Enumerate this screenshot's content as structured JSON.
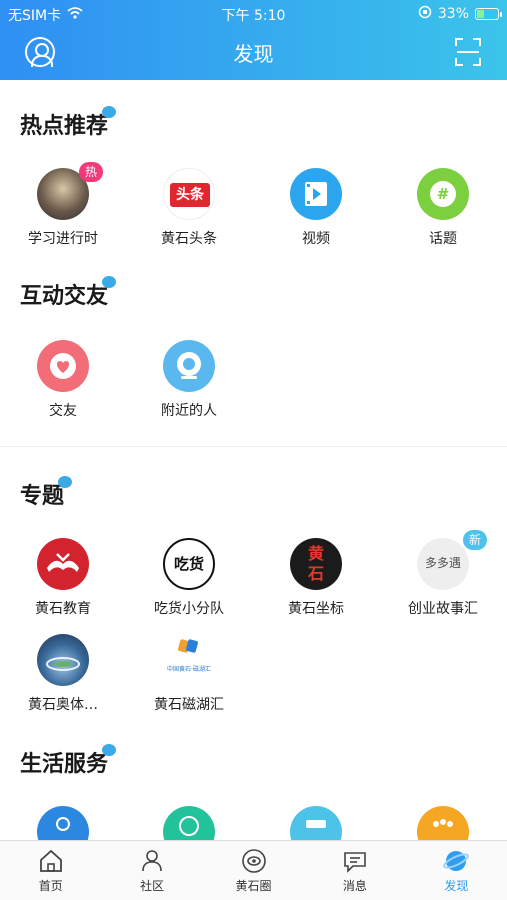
{
  "status": {
    "carrier": "无SIM卡",
    "time": "下午 5:10",
    "battery": "33%",
    "battery_level": 0.33
  },
  "nav": {
    "title": "发现"
  },
  "sections": {
    "hot": {
      "title": "热点推荐",
      "items": [
        {
          "label": "学习进行时",
          "badge": "热"
        },
        {
          "label": "黄石头条",
          "icon_text": "头条"
        },
        {
          "label": "视频"
        },
        {
          "label": "话题",
          "icon_text": "#"
        }
      ]
    },
    "interact": {
      "title": "互动交友",
      "items": [
        {
          "label": "交友"
        },
        {
          "label": "附近的人"
        }
      ]
    },
    "topics": {
      "title": "专题",
      "items": [
        {
          "label": "黄石教育"
        },
        {
          "label": "吃货小分队",
          "icon_text": "吃货"
        },
        {
          "label": "黄石坐标",
          "icon_text": "黄石"
        },
        {
          "label": "创业故事汇",
          "badge": "新",
          "icon_text": "多多遇"
        },
        {
          "label": "黄石奥体…"
        },
        {
          "label": "黄石磁湖汇",
          "icon_text": "中国黄石·磁湖汇"
        }
      ]
    },
    "life": {
      "title": "生活服务"
    }
  },
  "tabs": [
    {
      "label": "首页"
    },
    {
      "label": "社区"
    },
    {
      "label": "黄石圈"
    },
    {
      "label": "消息"
    },
    {
      "label": "发现"
    }
  ],
  "colors": {
    "header_start": "#2f8ff3",
    "header_end": "#3bc4ea",
    "active_tab": "#2f9df0"
  }
}
